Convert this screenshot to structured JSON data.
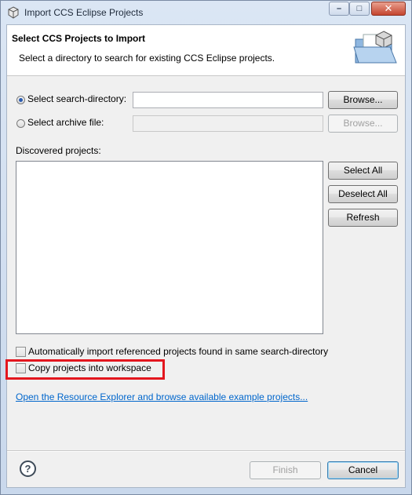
{
  "window": {
    "title": "Import CCS Eclipse Projects",
    "minimize_glyph": "–",
    "maximize_glyph": "□",
    "close_glyph": "✕"
  },
  "header": {
    "title": "Select CCS Projects to Import",
    "description": "Select a directory to search for existing CCS Eclipse projects."
  },
  "source": {
    "search_dir_label": "Select search-directory:",
    "search_dir_value": "",
    "search_dir_selected": true,
    "browse_label": "Browse...",
    "archive_label": "Select archive file:",
    "archive_value": "",
    "archive_browse_label": "Browse..."
  },
  "projects": {
    "label": "Discovered projects:",
    "items": [],
    "select_all_label": "Select All",
    "deselect_all_label": "Deselect All",
    "refresh_label": "Refresh"
  },
  "options": {
    "auto_import_label": "Automatically import referenced projects found in same search-directory",
    "auto_import_checked": false,
    "copy_label": "Copy projects into workspace",
    "copy_checked": false
  },
  "link": {
    "text": "Open the Resource Explorer and browse available example projects..."
  },
  "footer": {
    "help_glyph": "?",
    "finish_label": "Finish",
    "cancel_label": "Cancel"
  },
  "colors": {
    "highlight": "#e3161e",
    "link": "#0066cc"
  },
  "icons": {
    "app": "app-icon",
    "header": "folder-with-projects-icon",
    "help": "help-icon"
  }
}
